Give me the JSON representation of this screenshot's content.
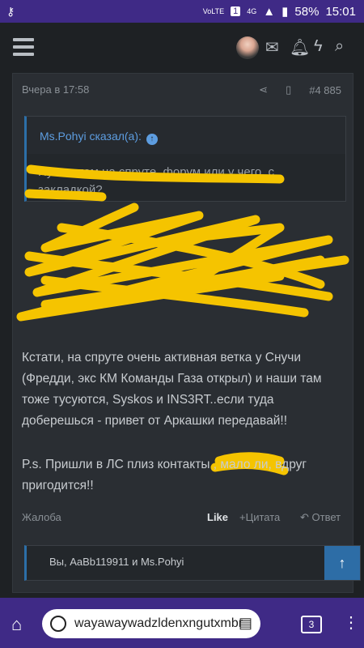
{
  "status": {
    "key_icon": "key-icon",
    "volte": "VoLTE",
    "sim": "1",
    "network": "4G",
    "battery": "58%",
    "time": "15:01"
  },
  "header": {
    "menu_icon": "hamburger-icon",
    "icons": [
      "mail-icon",
      "bell-icon",
      "bolt-icon",
      "search-icon"
    ]
  },
  "post": {
    "timestamp": "Вчера в 17:58",
    "post_number": "#4 885",
    "quote": {
      "author": "Ms.Pohyi сказал(а):",
      "text": "Ну что там на спруте, форум или у чего, с закладкой?"
    },
    "paragraphs": [
      "Кстати, на спруте очень активная ветка у Снучи (Фредди, экс КМ Команды Газа открыл) и наши там тоже тусуются, Syskos и INS3RT..если туда доберешься - привет от Аркашки передавай!!",
      "P.s. Пришли в ЛС плиз контакты , мало ли, вдруг пригодится!!"
    ],
    "actions": {
      "report": "Жалоба",
      "like": "Like",
      "quote": "Цитата",
      "reply": "Ответ"
    },
    "reactions": "Вы, AaBb119911 и Ms.Pohyi"
  },
  "browser": {
    "url": "wayawaywadzldenxngutxmbr",
    "tab_count": "3"
  },
  "colors": {
    "status_bar": "#3f2a86",
    "accent": "#2d6da6",
    "scribble": "#f5c400"
  }
}
